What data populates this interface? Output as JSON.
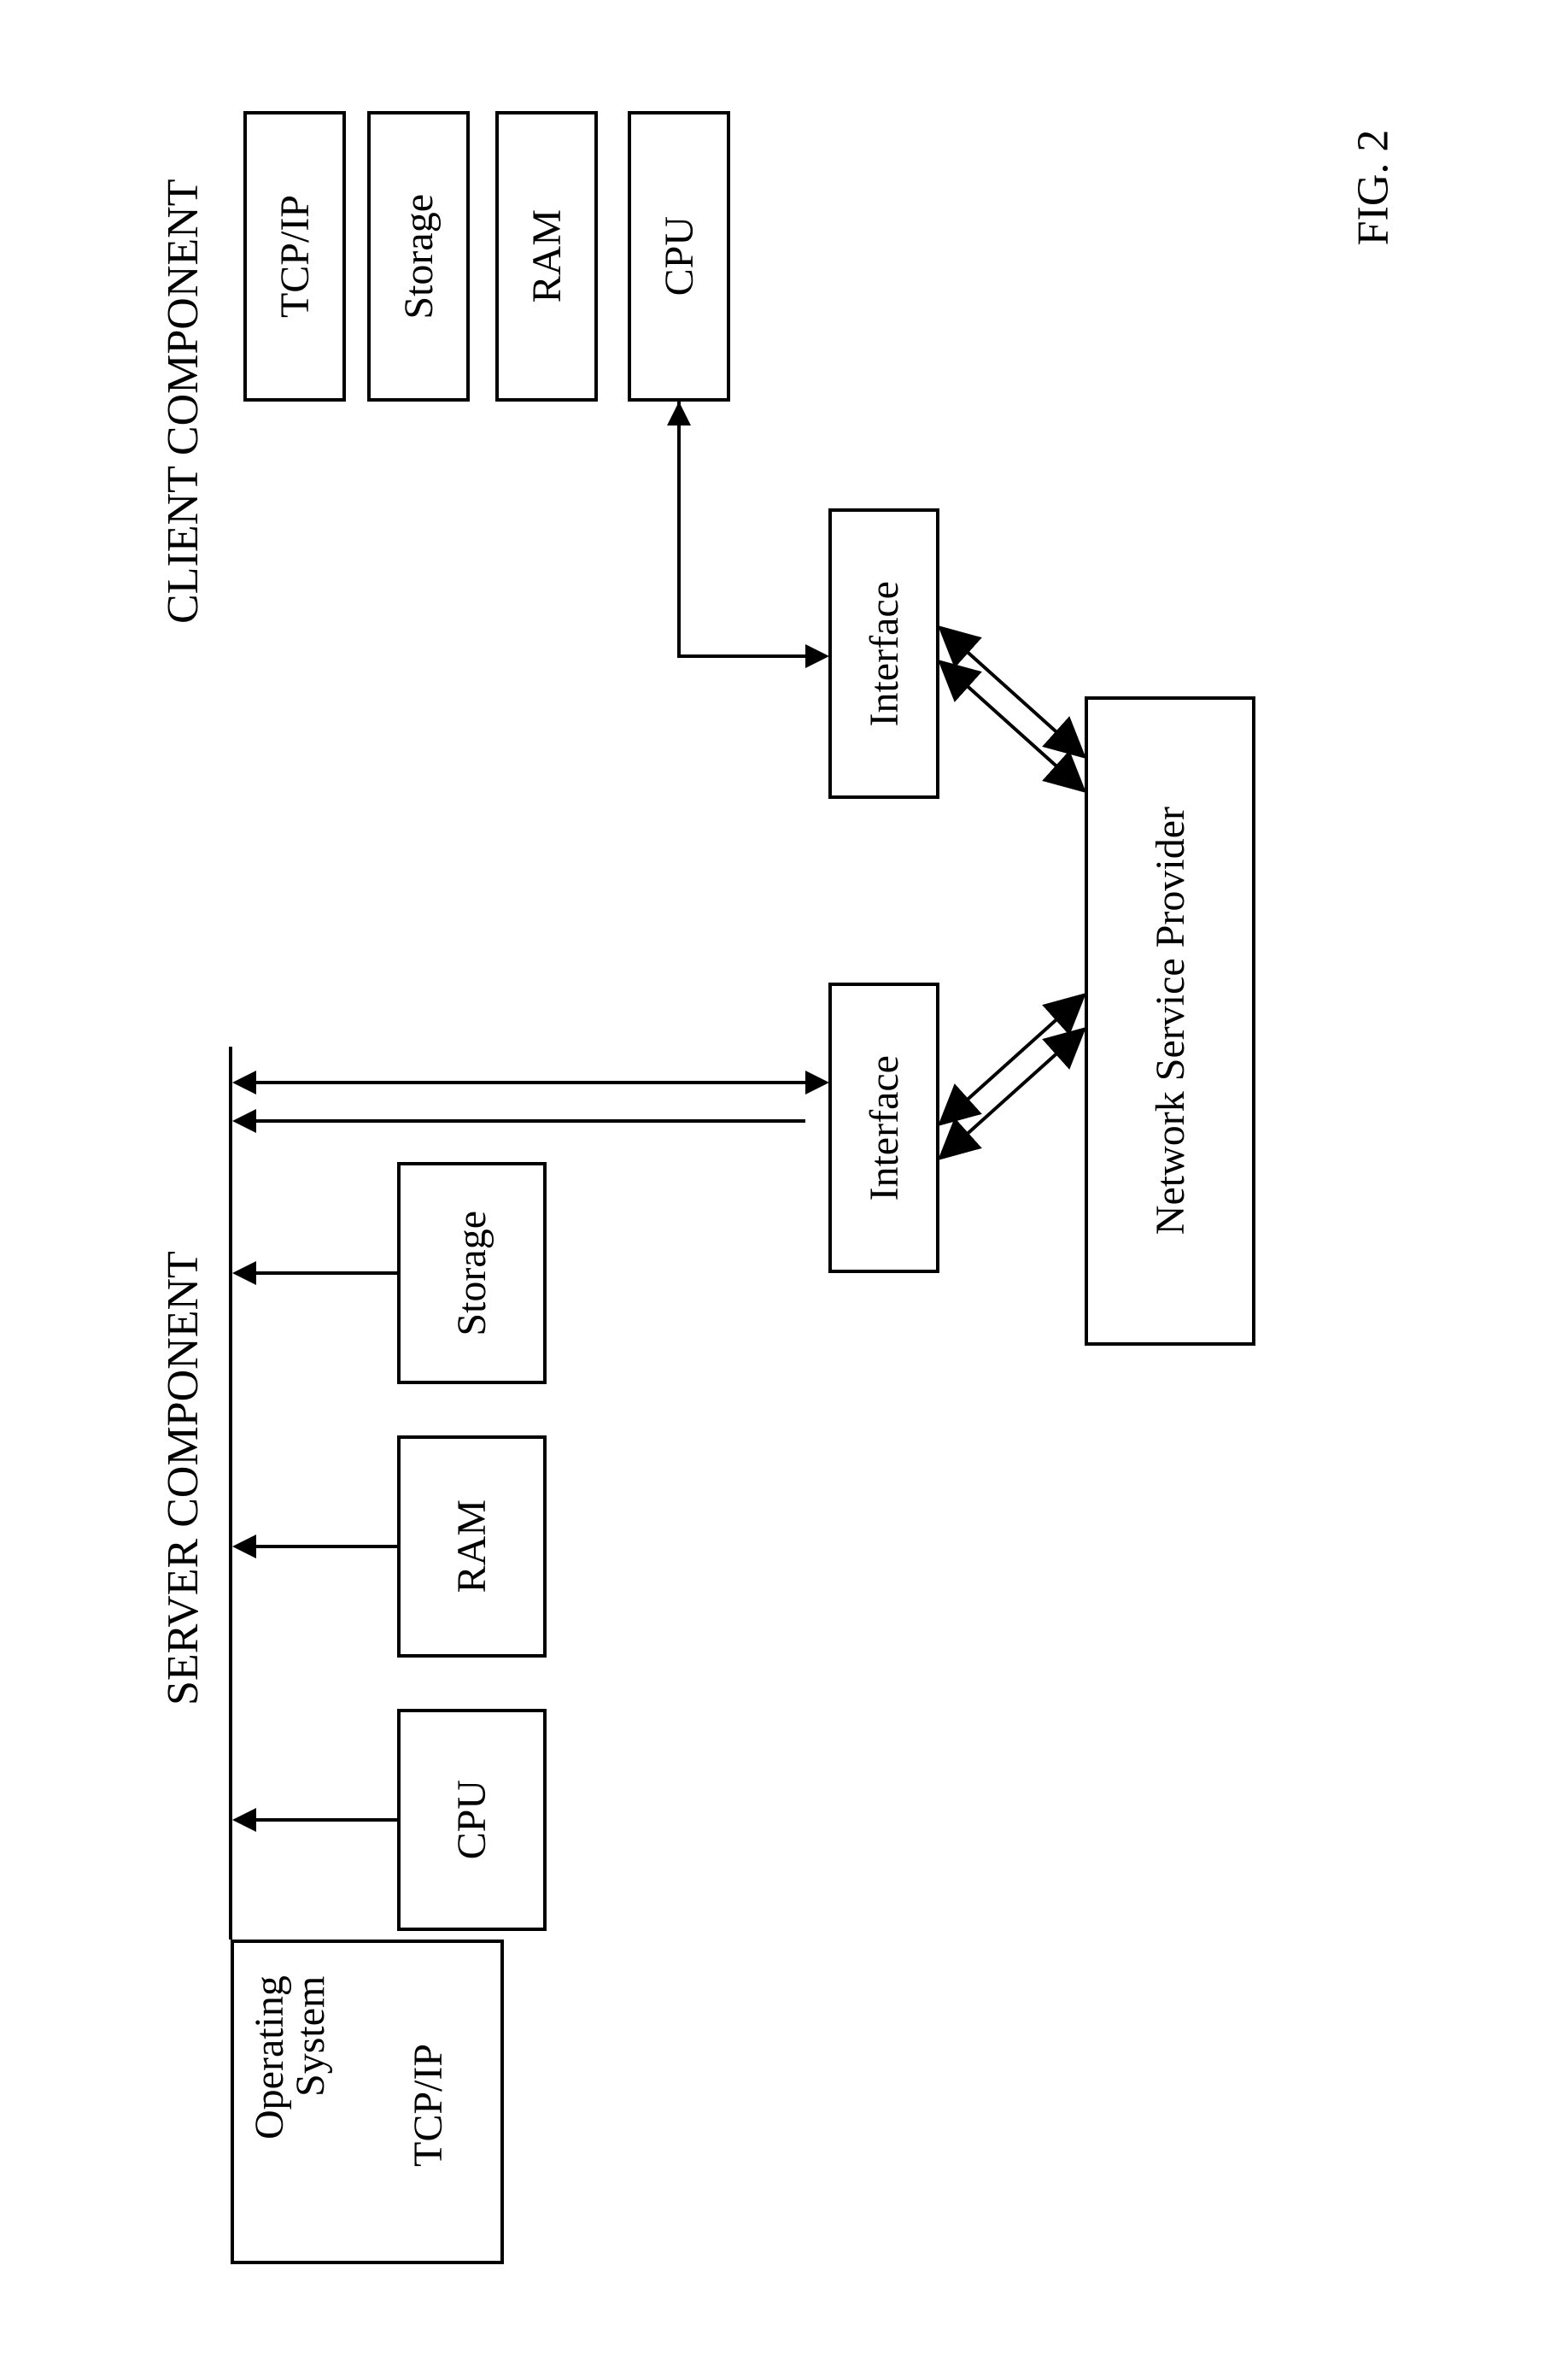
{
  "headers": {
    "client": "CLIENT COMPONENT",
    "server": "SERVER COMPONENT"
  },
  "client": {
    "tcpip": "TCP/IP",
    "storage": "Storage",
    "ram": "RAM",
    "cpu": "CPU"
  },
  "server": {
    "os_line1": "Operating",
    "os_line2": "System",
    "tcpip": "TCP/IP",
    "storage": "Storage",
    "ram": "RAM",
    "cpu": "CPU"
  },
  "net": {
    "interface_client": "Interface",
    "interface_server": "Interface",
    "nsp": "Network Service Provider"
  },
  "figure": "FIG. 2"
}
